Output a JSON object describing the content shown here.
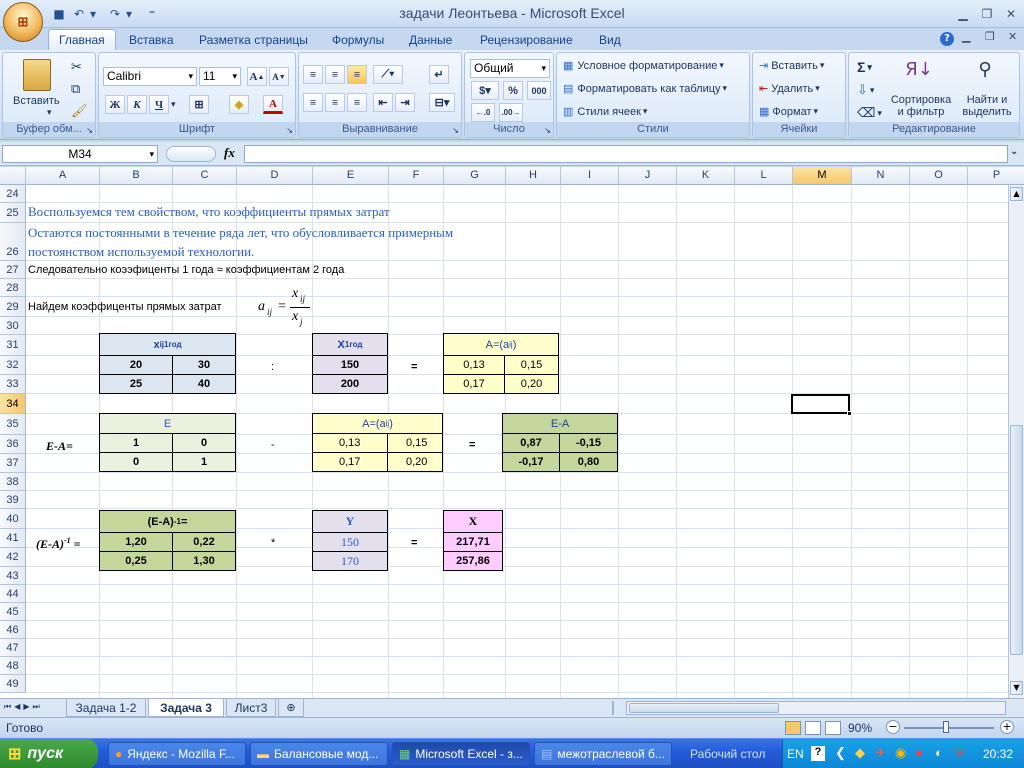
{
  "app": {
    "title": "задачи Леонтьева - Microsoft Excel"
  },
  "ribbon_tabs": [
    "Главная",
    "Вставка",
    "Разметка страницы",
    "Формулы",
    "Данные",
    "Рецензирование",
    "Вид"
  ],
  "ribbon": {
    "clipboard": {
      "paste": "Вставить",
      "title": "Буфер обм..."
    },
    "font": {
      "name": "Calibri",
      "size": "11",
      "bold": "Ж",
      "italic": "К",
      "underline": "Ч",
      "title": "Шрифт"
    },
    "alignment": {
      "title": "Выравнивание"
    },
    "number": {
      "format": "Общий",
      "percent": "%",
      "thousands": "000",
      "title": "Число"
    },
    "styles": {
      "conditional": "Условное форматирование",
      "table": "Форматировать как таблицу",
      "cell_styles": "Стили ячеек",
      "title": "Стили"
    },
    "cells": {
      "insert": "Вставить",
      "delete": "Удалить",
      "format": "Формат",
      "title": "Ячейки"
    },
    "editing": {
      "sum": "Σ",
      "sort": "Сортировка и фильтр",
      "find": "Найти и выделить",
      "title": "Редактирование"
    }
  },
  "formula_bar": {
    "name_box": "M34",
    "fx": "fx",
    "value": ""
  },
  "columns": [
    "A",
    "B",
    "C",
    "D",
    "E",
    "F",
    "G",
    "H",
    "I",
    "J",
    "K",
    "L",
    "M",
    "N",
    "O",
    "P"
  ],
  "selected_column": "M",
  "rows": [
    "24",
    "25",
    "26",
    "27",
    "28",
    "29",
    "30",
    "31",
    "32",
    "33",
    "34",
    "35",
    "36",
    "37",
    "38",
    "39",
    "40",
    "41",
    "42",
    "43",
    "44",
    "45",
    "46",
    "47",
    "48",
    "49"
  ],
  "selected_row": "34",
  "sheet": {
    "r25": "Воспользуемся тем свойством, что коэффициенты прямых затрат",
    "r26a": "Остаются постоянными в течение ряда лет, что обусловливается примерным",
    "r26b": "постоянством используемой технологии.",
    "r27": "Следовательно коээфиценты 1 года ≈ коэффициентам 2 года",
    "r29": "Найдем коэффиценты прямых затрат",
    "formula": {
      "lhs": "a",
      "lhs_sub": "ij",
      "eq": "=",
      "num": "x",
      "num_sub": "ij",
      "den": "x",
      "den_sub": "j"
    },
    "block1": {
      "x_header": "x",
      "x_header_sub": "ij",
      "x_header_sup": "1год",
      "x_values": [
        [
          "20",
          "30"
        ],
        [
          "25",
          "40"
        ]
      ],
      "colon": ":",
      "X_header": "X",
      "X_header_sup": "1год",
      "X_values": [
        "150",
        "200"
      ],
      "eq": "=",
      "A_header": "A=(a",
      "A_header_sub": "ij",
      "A_header_end": ")",
      "A_values": [
        [
          "0,13",
          "0,15"
        ],
        [
          "0,17",
          "0,20"
        ]
      ]
    },
    "block2": {
      "label": "E-A=",
      "E_header": "E",
      "E_values": [
        [
          "1",
          "0"
        ],
        [
          "0",
          "1"
        ]
      ],
      "minus": "-",
      "A_header": "A=(a",
      "A_header_sub": "ij",
      "A_header_end": ")",
      "A_values": [
        [
          "0,13",
          "0,15"
        ],
        [
          "0,17",
          "0,20"
        ]
      ],
      "eq": "=",
      "EA_header": "E-A",
      "EA_values": [
        [
          "0,87",
          "-0,15"
        ],
        [
          "-0,17",
          "0,80"
        ]
      ]
    },
    "block3": {
      "label": "(E-A)",
      "label_sup": "-1",
      "label_end": " =",
      "inv_header": "(E-A)",
      "inv_header_sup": "-1",
      "inv_header_end": "=",
      "inv_values": [
        [
          "1,20",
          "0,22"
        ],
        [
          "0,25",
          "1,30"
        ]
      ],
      "times": "*",
      "Y_header": "Y",
      "Y_values": [
        "150",
        "170"
      ],
      "eq": "=",
      "X_header": "X",
      "X_values": [
        "217,71",
        "257,86"
      ]
    }
  },
  "sheet_tabs": [
    "Задача 1-2",
    "Задача 3",
    "Лист3"
  ],
  "active_sheet": "Задача 3",
  "status": {
    "ready": "Готово",
    "zoom": "90%"
  },
  "taskbar": {
    "start": "пуск",
    "tasks": [
      "Яндекс - Mozilla F...",
      "Балансовые мод...",
      "Microsoft Excel - з...",
      "межотраслевой б..."
    ],
    "desktop": "Рабочий стол",
    "lang": "EN",
    "time": "20:32"
  },
  "colors": {
    "blue_header": "#dce6f1",
    "yellow_fill": "#ffffcc",
    "green_fill": "#d8e4bc",
    "green_dark": "#c4d79b",
    "lavender": "#e4dfec",
    "pink": "#ffccff",
    "blue_text": "#2561c5"
  }
}
